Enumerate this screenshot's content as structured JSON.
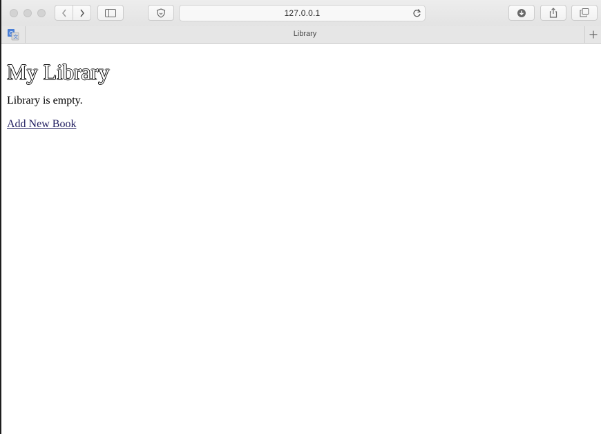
{
  "browser": {
    "address": "127.0.0.1",
    "tab_title": "Library",
    "extension_icon": "google-translate-icon"
  },
  "page": {
    "heading": "My Library",
    "empty_message": "Library is empty.",
    "add_link": "Add New Book"
  }
}
